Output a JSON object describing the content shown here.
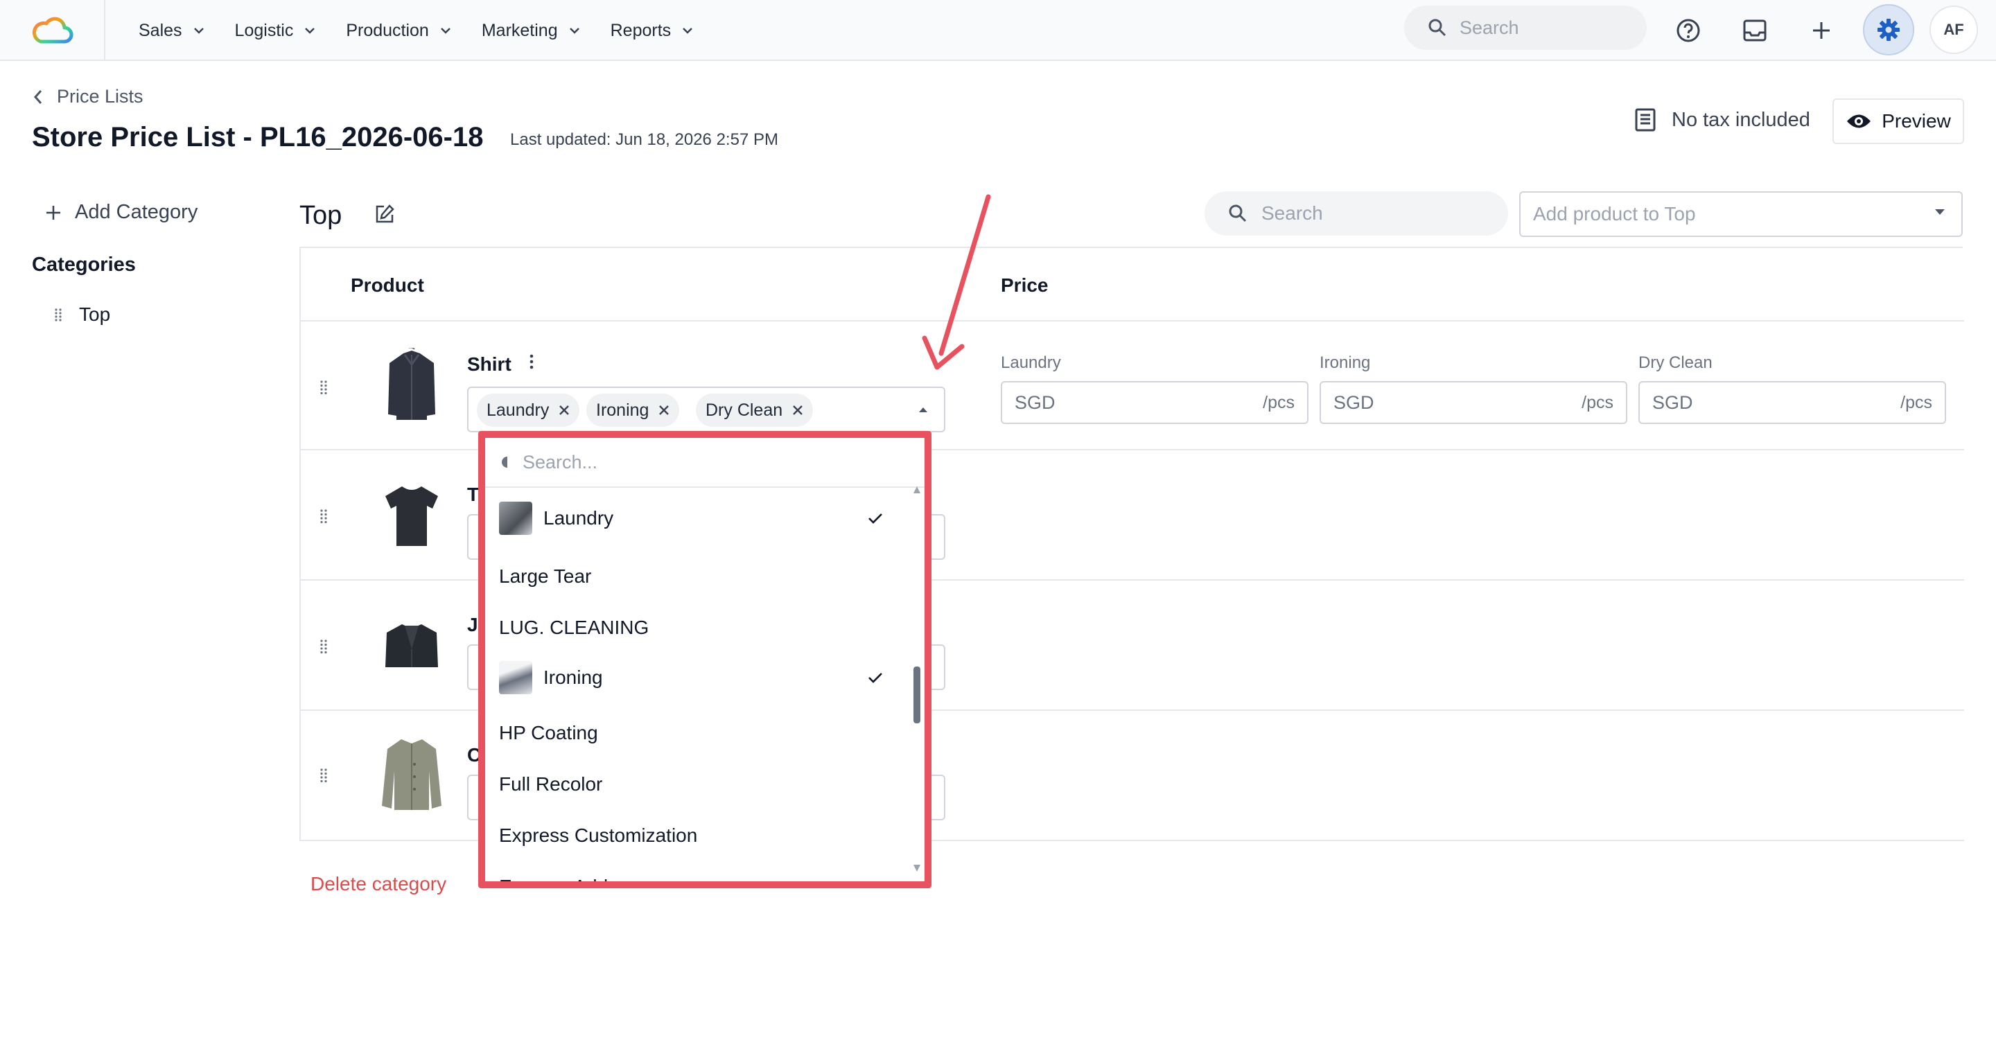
{
  "nav": {
    "items": [
      {
        "label": "Sales"
      },
      {
        "label": "Logistic"
      },
      {
        "label": "Production"
      },
      {
        "label": "Marketing"
      },
      {
        "label": "Reports"
      }
    ],
    "search_placeholder": "Search",
    "avatar_initials": "AF"
  },
  "header": {
    "breadcrumb": "Price Lists",
    "title": "Store Price List - PL16_2026-06-18",
    "last_updated": "Last updated: Jun 18, 2026 2:57 PM",
    "tax_label": "No tax included",
    "preview_label": "Preview"
  },
  "sidebar": {
    "add_category": "Add Category",
    "categories_label": "Categories",
    "categories": [
      {
        "label": "Top"
      }
    ],
    "delete_category": "Delete category"
  },
  "main": {
    "category_title": "Top",
    "search_placeholder": "Search",
    "add_product_placeholder": "Add product to Top",
    "columns": {
      "product": "Product",
      "price": "Price"
    },
    "rows": [
      {
        "name": "Shirt",
        "services": [
          "Laundry",
          "Ironing",
          "Dry Clean"
        ],
        "prices": [
          {
            "label": "Laundry",
            "currency": "SGD",
            "unit": "/pcs"
          },
          {
            "label": "Ironing",
            "currency": "SGD",
            "unit": "/pcs"
          },
          {
            "label": "Dry Clean",
            "currency": "SGD",
            "unit": "/pcs"
          }
        ]
      },
      {
        "name": "T"
      },
      {
        "name": "Ja"
      },
      {
        "name": "C"
      }
    ]
  },
  "dropdown": {
    "search_placeholder": "Search...",
    "options": [
      {
        "label": "Laundry",
        "icon": "laundry-image",
        "selected": true
      },
      {
        "label": "Large Tear",
        "selected": false
      },
      {
        "label": "LUG. CLEANING",
        "selected": false
      },
      {
        "label": "Ironing",
        "icon": "iron-image",
        "selected": true
      },
      {
        "label": "HP Coating",
        "selected": false
      },
      {
        "label": "Full Recolor",
        "selected": false
      },
      {
        "label": "Express Customization",
        "selected": false
      },
      {
        "label": "Express Add-on",
        "selected": false
      }
    ]
  },
  "colors": {
    "highlight": "#e8525f",
    "accent": "#1d5fc4",
    "danger": "#dc4b4b"
  }
}
